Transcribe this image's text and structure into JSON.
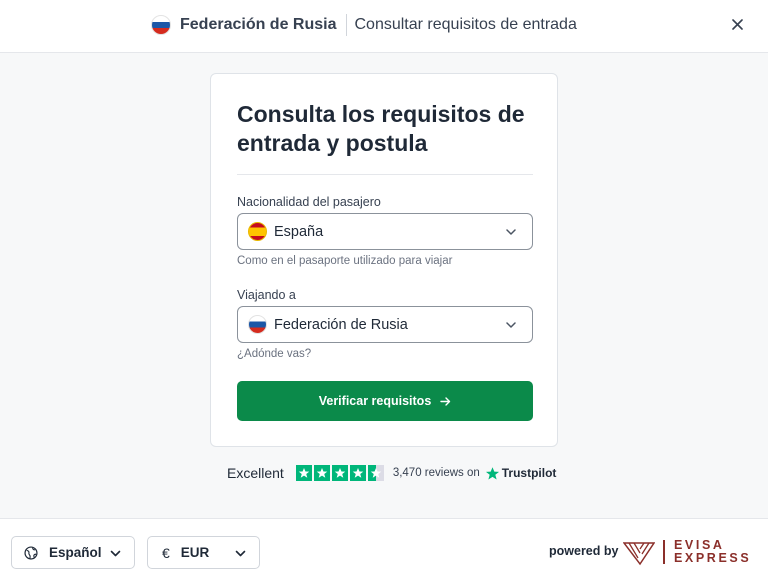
{
  "header": {
    "country": "Federación de Rusia",
    "subtitle": "Consultar requisitos de entrada",
    "flag_icon": "russia-flag-icon",
    "close_icon": "close-icon"
  },
  "card": {
    "title": "Consulta los requisitos de entrada y postula",
    "nationality": {
      "label": "Nacionalidad del pasajero",
      "value": "España",
      "flag_icon": "spain-flag-icon",
      "helper": "Como en el pasaporte utilizado para viajar"
    },
    "destination": {
      "label": "Viajando a",
      "value": "Federación de Rusia",
      "flag_icon": "russia-flag-icon",
      "helper": "¿Adónde vas?"
    },
    "submit_label": "Verificar requisitos"
  },
  "trustpilot": {
    "rating_text": "Excellent",
    "stars": 4.5,
    "reviews": "3,470 reviews on",
    "brand": "Trustpilot"
  },
  "footer": {
    "language": "Español",
    "currency_symbol": "€",
    "currency": "EUR",
    "powered_by": "powered by",
    "brand_line1": "EVISA",
    "brand_line2": "EXPRESS"
  },
  "colors": {
    "primary_button": "#0b8a4a",
    "trustpilot_green": "#00b67a",
    "brand": "#8b2f2a"
  }
}
